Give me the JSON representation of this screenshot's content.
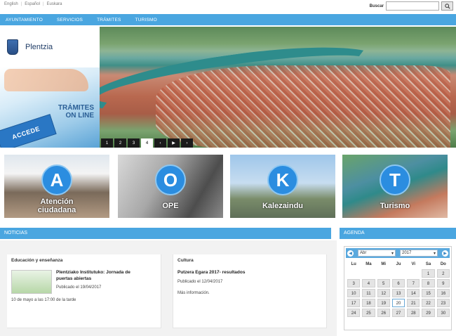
{
  "languages": [
    "English",
    "Español",
    "Euskara"
  ],
  "search": {
    "label": "Buscar",
    "placeholder": ""
  },
  "nav": [
    "AYUNTAMIENTO",
    "SERVICIOS",
    "TRÁMITES",
    "TURISMO"
  ],
  "logo": {
    "name": "Plentzia"
  },
  "tramites_banner": {
    "line1": "TRÁMITES",
    "line2": "ON LINE",
    "button": "ACCEDE"
  },
  "slider": {
    "pages": [
      "1",
      "2",
      "3",
      "4"
    ],
    "active_page": "4",
    "prev": "‹",
    "next": "›",
    "play": "▶"
  },
  "tiles": [
    {
      "letter": "A",
      "label_line1": "Atención",
      "label_line2": "ciudadana",
      "colors": [
        "#7a6a5a",
        "#b29a83"
      ]
    },
    {
      "letter": "O",
      "label_line1": "OPE",
      "label_line2": "",
      "colors": [
        "#4d4d4d",
        "#8a8a8a"
      ]
    },
    {
      "letter": "K",
      "label_line1": "Kalezaindu",
      "label_line2": "",
      "colors": [
        "#7fa9d0",
        "#7a8c6a"
      ]
    },
    {
      "letter": "T",
      "label_line1": "Turismo",
      "label_line2": "",
      "colors": [
        "#4d8fa1",
        "#c47a5e"
      ]
    }
  ],
  "news": {
    "header": "NOTICIAS",
    "items": [
      {
        "category": "Educación y enseñanza",
        "title_line1": "Plentziako Institutuko: Jornada de",
        "title_line2": "puertas abiertas",
        "date": "Publicado el 19/04/2017",
        "extra": "10 de mayo a las 17:00 de la tarde"
      },
      {
        "category": "Cultura",
        "title_line1": "Putzera Egara 2017- resultados",
        "title_line2": "",
        "date": "Publicado el 12/04/2017",
        "extra": "Más información."
      }
    ]
  },
  "agenda": {
    "header": "AGENDA",
    "month": "Abr",
    "year": "2017",
    "weekdays": [
      "Lu",
      "Ma",
      "Mi",
      "Ju",
      "Vi",
      "Sa",
      "Do"
    ],
    "weeks": [
      [
        "",
        "",
        "",
        "",
        "",
        "1",
        "2"
      ],
      [
        "3",
        "4",
        "5",
        "6",
        "7",
        "8",
        "9"
      ],
      [
        "10",
        "11",
        "12",
        "13",
        "14",
        "15",
        "16"
      ],
      [
        "17",
        "18",
        "19",
        "20",
        "21",
        "22",
        "23"
      ],
      [
        "24",
        "25",
        "26",
        "27",
        "28",
        "29",
        "30"
      ]
    ],
    "today": "20"
  }
}
